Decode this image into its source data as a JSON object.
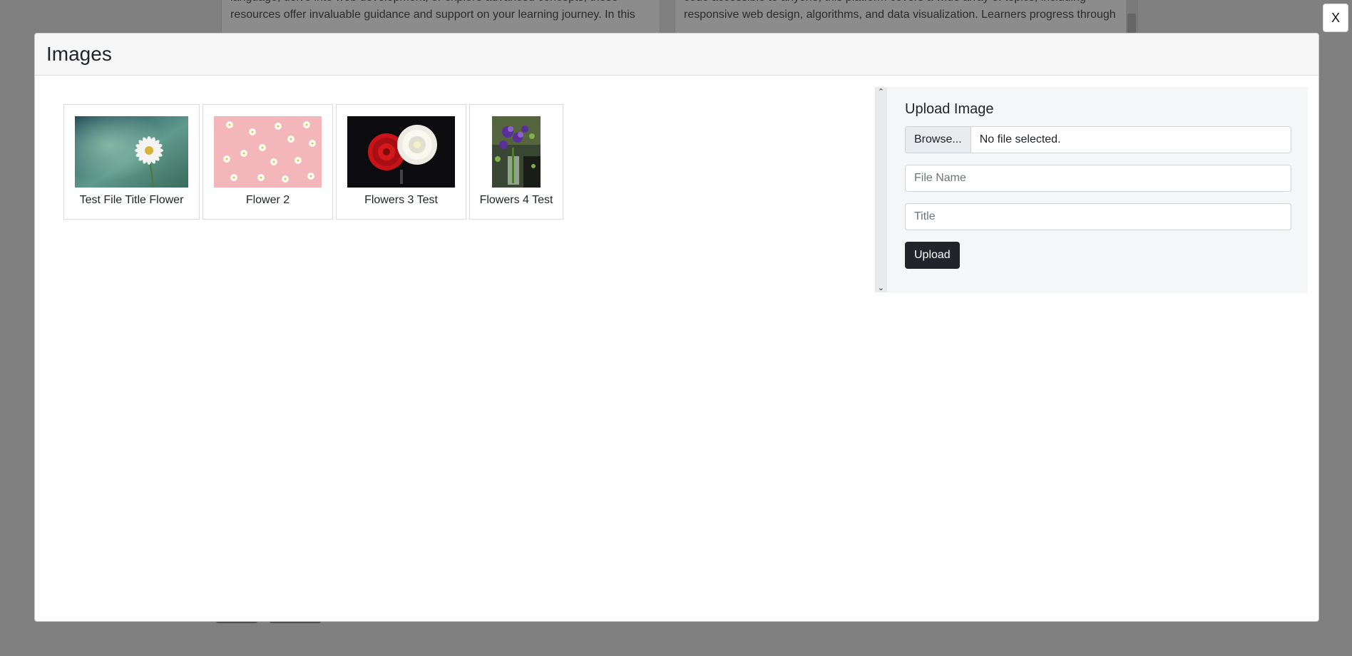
{
  "background": {
    "left_text": "styles and skill levels. Whether you're aiming to master a new programming language, delve into web development, or explore advanced concepts, these resources offer invaluable guidance and support on your learning journey. In this",
    "right_text": "tutorials, and certifications, all available at no cost. With a mission to make learning to code accessible to anyone, this platform covers a wide array of topics, including responsive web design, algorithms, and data visualization. Learners progress through"
  },
  "close_label": "X",
  "modal": {
    "title": "Images",
    "images": [
      {
        "caption": "Test File Title Flower"
      },
      {
        "caption": "Flower 2"
      },
      {
        "caption": "Flowers 3 Test"
      },
      {
        "caption": "Flowers 4 Test"
      }
    ],
    "upload": {
      "title": "Upload Image",
      "browse_label": "Browse...",
      "file_status": "No file selected.",
      "filename_placeholder": "File Name",
      "title_placeholder": "Title",
      "submit_label": "Upload"
    }
  },
  "colors": {
    "overlay": "#808080",
    "upload_button": "#212529",
    "panel_background": "#f5f6f8"
  }
}
